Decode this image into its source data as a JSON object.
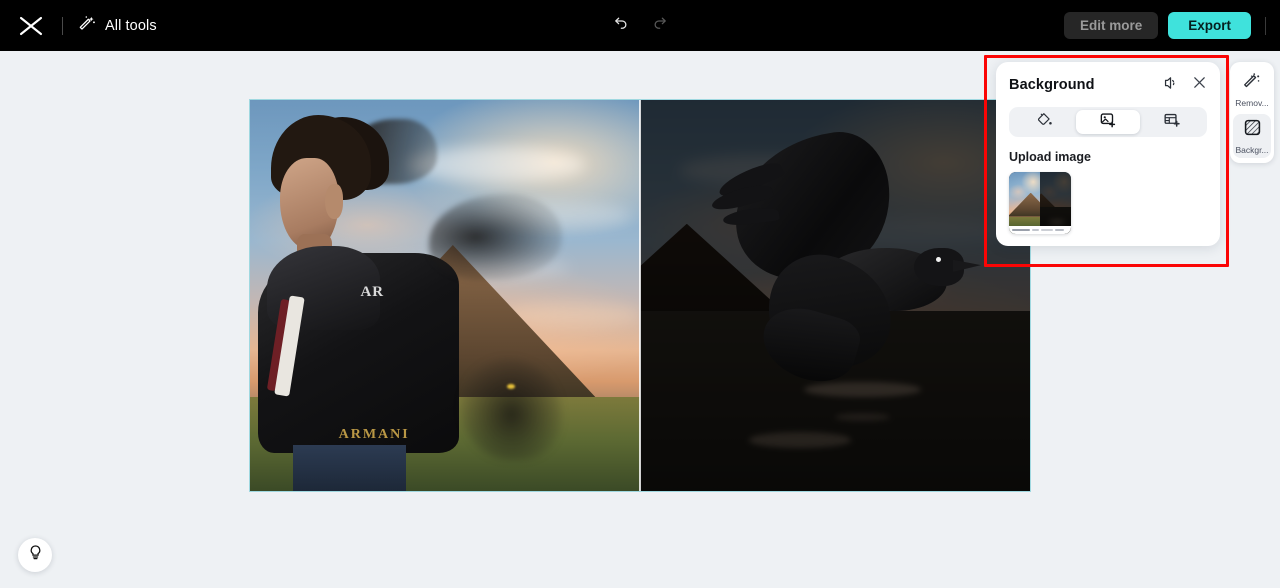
{
  "app": {
    "name": "CapCut Online Editor",
    "logo_icon": "capcut-logo-icon"
  },
  "topbar": {
    "all_tools_label": "All tools",
    "all_tools_icon": "magic-wand-icon",
    "undo_icon": "undo-arrow-icon",
    "redo_icon": "redo-arrow-icon",
    "edit_more_label": "Edit more",
    "export_label": "Export",
    "export_color": "#3fe2dc"
  },
  "canvas": {
    "selection_border_color": "#9fd8e0",
    "background_color": "#eef1f4",
    "left_panel_caption": "ARMANI",
    "left_panel_caption_small": "AR",
    "split_divider": "vertical-split-divider"
  },
  "tool_rail": {
    "items": [
      {
        "label": "Remov...",
        "icon": "magic-wand-remove-icon",
        "active": false
      },
      {
        "label": "Backgr...",
        "icon": "background-hatch-icon",
        "active": true
      }
    ]
  },
  "background_panel": {
    "title": "Background",
    "compare_icon": "compare-view-icon",
    "close_icon": "close-x-icon",
    "tabs": [
      {
        "name": "color-fill",
        "icon": "paint-bucket-icon",
        "active": false
      },
      {
        "name": "upload-image",
        "icon": "image-plus-icon",
        "active": true
      },
      {
        "name": "template",
        "icon": "template-plus-icon",
        "active": false
      }
    ],
    "upload_label": "Upload image",
    "thumbnail_name": "uploaded-background-thumbnail"
  },
  "hint": {
    "icon": "lightbulb-icon"
  },
  "annotation": {
    "highlight_color": "#fb0505",
    "target": "background-panel"
  }
}
